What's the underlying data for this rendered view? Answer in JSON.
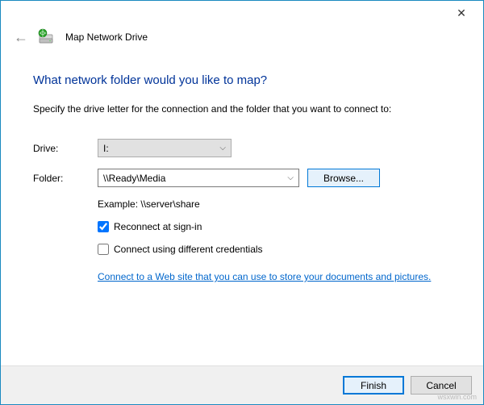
{
  "titlebar": {
    "close": "✕"
  },
  "header": {
    "back_arrow": "←",
    "title": "Map Network Drive"
  },
  "content": {
    "heading": "What network folder would you like to map?",
    "subtext": "Specify the drive letter for the connection and the folder that you want to connect to:",
    "drive_label": "Drive:",
    "drive_value": "I:",
    "folder_label": "Folder:",
    "folder_value": "\\\\Ready\\Media",
    "browse_label": "Browse...",
    "example_text": "Example: \\\\server\\share",
    "reconnect_label": "Reconnect at sign-in",
    "reconnect_checked": true,
    "credentials_label": "Connect using different credentials",
    "credentials_checked": false,
    "link_text": "Connect to a Web site that you can use to store your documents and pictures."
  },
  "footer": {
    "finish_label": "Finish",
    "cancel_label": "Cancel"
  },
  "watermark": "wsxwin.com"
}
